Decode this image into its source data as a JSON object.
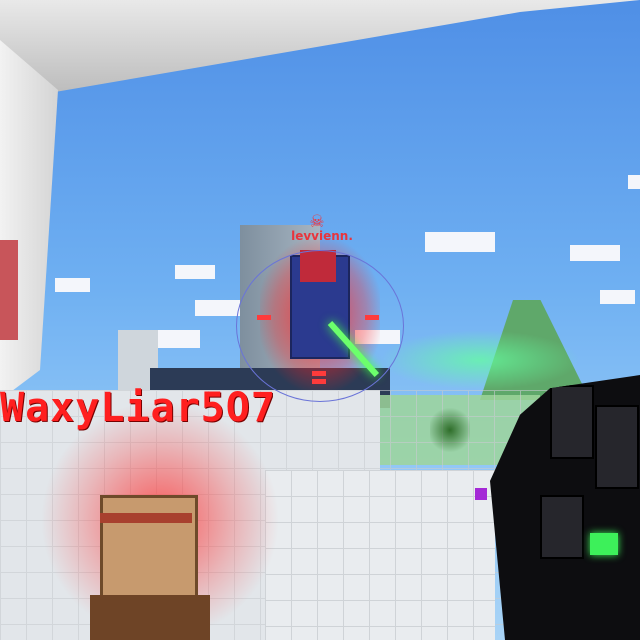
{
  "hud": {
    "player_nametag": "WaxyLiar5O7",
    "enemy_nametag": "levvienn.",
    "enemy_status_icon": "skull-icon",
    "crosshair": "circle-crosshair"
  },
  "colors": {
    "nametag_red": "#ff1f1f",
    "enemy_glow": "#ff1e1e",
    "laser_green": "#6cff6c",
    "crosshair_ring": "#6a74d8",
    "sky": "#6fb0f2"
  }
}
